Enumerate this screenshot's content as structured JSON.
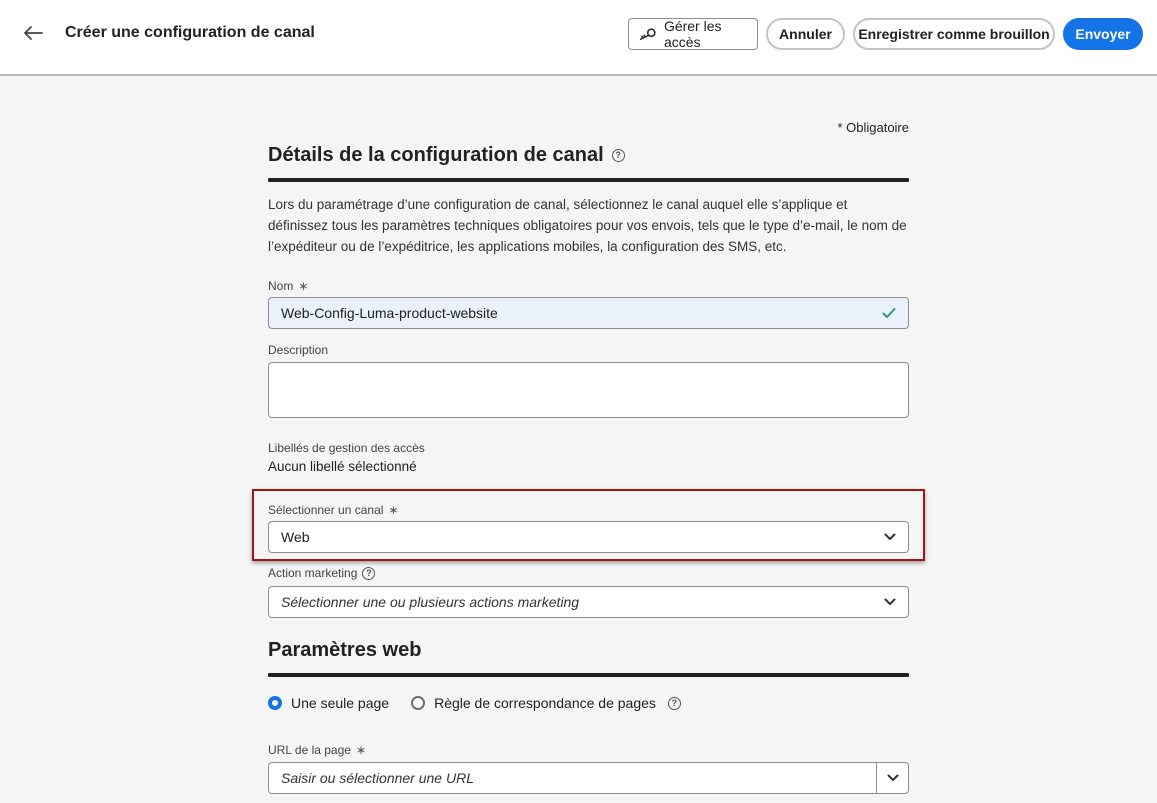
{
  "header": {
    "title": "Créer une configuration de canal",
    "manage_access_label": "Gérer les accès",
    "cancel_label": "Annuler",
    "draft_label": "Enregistrer comme brouillon",
    "send_label": "Envoyer"
  },
  "form": {
    "required_note": "* Obligatoire",
    "details_title": "Détails de la configuration de canal",
    "intro": "Lors du paramétrage d’une configuration de canal, sélectionnez le canal auquel elle s’applique et définissez tous les paramètres techniques obligatoires pour vos envois, tels que le type d’e-mail, le nom de l’expéditeur ou de l’expéditrice, les applications mobiles, la configuration des SMS, etc.",
    "name_label": "Nom",
    "name_value": "Web-Config-Luma-product-website",
    "description_label": "Description",
    "description_value": "",
    "access_labels_label": "Libellés de gestion des accès",
    "access_labels_value": "Aucun libellé sélectionné",
    "channel_label": "Sélectionner un canal",
    "channel_value": "Web",
    "marketing_label": "Action marketing",
    "marketing_placeholder": "Sélectionner une ou plusieurs actions marketing",
    "web_title": "Paramètres web",
    "radio_single": "Une seule page",
    "radio_rule": "Règle de correspondance de pages",
    "url_label": "URL de la page",
    "url_placeholder": "Saisir ou sélectionner une URL",
    "required_star": "∗"
  },
  "colors": {
    "accent": "#1473e6",
    "highlight": "#a31515",
    "valid_check": "#2d9d78"
  }
}
